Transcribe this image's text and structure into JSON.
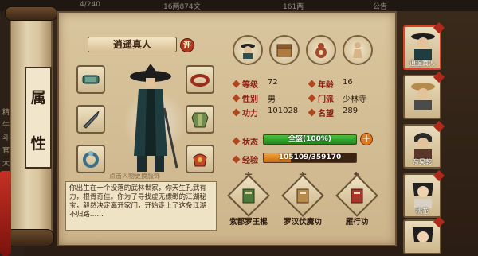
{
  "top_bar": {
    "items": [
      "4/240",
      "16两874文",
      "161两",
      "公告"
    ]
  },
  "scroll": {
    "title_chars": [
      "属",
      "性"
    ]
  },
  "left_bg_text": [
    "精",
    "牛",
    "斗",
    "官",
    "大"
  ],
  "character": {
    "name": "逍遥真人",
    "rate_badge": "评",
    "change_hint": "点击人物更换服饰",
    "description": "你出生在一个没落的武林世家，你天生孔武有力，根骨奇佳。你为了寻找虚无缥缈的江湖秘宝，毅然决定离开家门，开始走上了这条江湖不归路……"
  },
  "equipment": [
    {
      "slot": "weapon",
      "icon": "bracer-icon"
    },
    {
      "slot": "ring",
      "icon": "ring-icon"
    },
    {
      "slot": "hidden-weapon",
      "icon": "dart-icon"
    },
    {
      "slot": "armor",
      "icon": "armor-icon"
    },
    {
      "slot": "charm",
      "icon": "blue-ring-icon"
    },
    {
      "slot": "accessory",
      "icon": "pouch-icon"
    }
  ],
  "tab_icons": [
    "portrait-tab-icon",
    "chest-tab-icon",
    "gourd-tab-icon",
    "figure-tab-icon"
  ],
  "stats": {
    "level_label": "等级",
    "level": "72",
    "age_label": "年龄",
    "age": "16",
    "gender_label": "性别",
    "gender": "男",
    "sect_label": "门派",
    "sect": "少林寺",
    "power_label": "功力",
    "power": "101028",
    "fame_label": "名望",
    "fame": "289"
  },
  "status": {
    "label": "状态",
    "text": "全盛(100%)",
    "fraction": 1.0
  },
  "experience": {
    "label": "经验",
    "text": "105109/359170",
    "current": 105109,
    "max": 359170
  },
  "plus_button": "+",
  "skills": [
    {
      "level": "六",
      "name": "紫郡罗王棍",
      "icon": "book-green-icon"
    },
    {
      "level": "六",
      "name": "罗汉伏魔功",
      "icon": "book-scroll-icon"
    },
    {
      "level": "九",
      "name": "雁行功",
      "icon": "book-red-icon"
    }
  ],
  "party": [
    {
      "name": "逍遥真人",
      "selected": true
    },
    {
      "name": "",
      "selected": false
    },
    {
      "name": "帝昊乾",
      "selected": false
    },
    {
      "name": "桃花",
      "selected": false
    },
    {
      "name": "",
      "selected": false
    }
  ],
  "colors": {
    "accent_red": "#8a2012",
    "status_green": "#2ea826",
    "exp_orange": "#e08a22"
  }
}
